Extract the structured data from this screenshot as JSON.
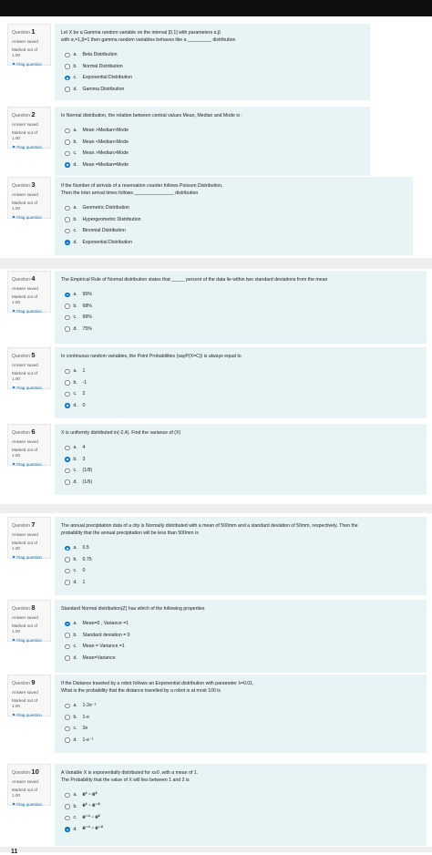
{
  "questions": [
    {
      "label": "Question",
      "num": "1",
      "state": "Answer saved",
      "mark_label": "Marked out of",
      "mark": "1.00",
      "flag": "Flag question",
      "text": [
        "Let X be a Gamma random variable  on the interval [0,1] with parameters α,β",
        "with   α,=1,β=1 then gamma random variables behaves like a _________ distribution"
      ],
      "options": [
        {
          "l": "a.",
          "t": "Beta Distribution",
          "sel": false
        },
        {
          "l": "b.",
          "t": "Normal Distribution",
          "sel": false
        },
        {
          "l": "c.",
          "t": "Exponential Distribution",
          "sel": true
        },
        {
          "l": "d.",
          "t": "Gamma Distribution",
          "sel": false
        }
      ]
    },
    {
      "label": "Question",
      "num": "2",
      "state": "Answer saved",
      "mark_label": "Marked out of",
      "mark": "1.00",
      "flag": "Flag question",
      "text": [
        "In Normal distribution, the relation between central values Mean, Median and Mode is :"
      ],
      "options": [
        {
          "l": "a.",
          "t": "Mean >Median<Mode",
          "sel": false
        },
        {
          "l": "b.",
          "t": "Mean <Median<Mode",
          "sel": false
        },
        {
          "l": "c.",
          "t": "Mean >Median>Mode",
          "sel": false
        },
        {
          "l": "d.",
          "t": "Mean =Median=Mode",
          "sel": true
        }
      ]
    },
    {
      "label": "Question",
      "num": "3",
      "state": "Answer saved",
      "mark_label": "Marked out of",
      "mark": "1.00",
      "flag": "Flag question",
      "text": [
        "If the Number of arrivals of a reservation counter follows Poisson Distribution,",
        "Then the Inter arrival times follows _______________ distribution"
      ],
      "options": [
        {
          "l": "a.",
          "t": "Geometric Distribution",
          "sel": false
        },
        {
          "l": "b.",
          "t": "Hypergeometric Distribution",
          "sel": false
        },
        {
          "l": "c.",
          "t": "Binomial Distribution",
          "sel": false
        },
        {
          "l": "d.",
          "t": "Exponential Distribution",
          "sel": true
        }
      ]
    },
    {
      "label": "Question",
      "num": "4",
      "state": "Answer saved",
      "mark_label": "Marked out of",
      "mark": "1.00",
      "flag": "Flag question",
      "text": [
        "The Empirical Rule of Normal distribution states that _____ percent of the data lie  within two standard deviations from the mean"
      ],
      "options": [
        {
          "l": "a.",
          "t": "95%",
          "sel": true
        },
        {
          "l": "b.",
          "t": "68%",
          "sel": false
        },
        {
          "l": "c.",
          "t": "99%",
          "sel": false
        },
        {
          "l": "d.",
          "t": "75%",
          "sel": false
        }
      ]
    },
    {
      "label": "Question",
      "num": "5",
      "state": "Answer saved",
      "mark_label": "Marked out of",
      "mark": "1.00",
      "flag": "Flag question",
      "text": [
        "In continuous random variables, the Point Probabilities (sayP(X=C)) is always equal to"
      ],
      "options": [
        {
          "l": "a.",
          "t": "1",
          "sel": false
        },
        {
          "l": "b.",
          "t": "-1",
          "sel": false
        },
        {
          "l": "c.",
          "t": "2",
          "sel": false
        },
        {
          "l": "d.",
          "t": "0",
          "sel": true
        }
      ]
    },
    {
      "label": "Question",
      "num": "6",
      "state": "Answer saved",
      "mark_label": "Marked out of",
      "mark": "1.00",
      "flag": "Flag question",
      "text": [
        "X is uniformly distributed in(-2,4). Find the variance of (X)"
      ],
      "options": [
        {
          "l": "a.",
          "t": "4",
          "sel": false
        },
        {
          "l": "b.",
          "t": "3",
          "sel": true
        },
        {
          "l": "c.",
          "t": "(1/8)",
          "sel": false
        },
        {
          "l": "d.",
          "t": "(1/6)",
          "sel": false
        }
      ]
    },
    {
      "label": "Question",
      "num": "7",
      "state": "Answer saved",
      "mark_label": "Marked out of",
      "mark": "1.00",
      "flag": "Flag question",
      "text": [
        "The annual precipitation data of a city is Normally distributed with a mean of  500mm and a standard deviation of 50mm, respectively. Then the",
        "probability that the annual precipitation will be less than 500mm is"
      ],
      "options": [
        {
          "l": "a.",
          "t": "0.5",
          "sel": true
        },
        {
          "l": "b.",
          "t": "0.75",
          "sel": false
        },
        {
          "l": "c.",
          "t": "0",
          "sel": false
        },
        {
          "l": "d.",
          "t": "1",
          "sel": false
        }
      ]
    },
    {
      "label": "Question",
      "num": "8",
      "state": "Answer saved",
      "mark_label": "Marked out of",
      "mark": "1.00",
      "flag": "Flag question",
      "text": [
        "Standard Normal distribution(Z) has which of the following properties"
      ],
      "options": [
        {
          "l": "a.",
          "t": "Mean=0 , Variance =1",
          "sel": true
        },
        {
          "l": "b.",
          "t": "Standard deviation = 0",
          "sel": false
        },
        {
          "l": "c.",
          "t": "Mean = Variance =1",
          "sel": false
        },
        {
          "l": "d.",
          "t": "Mean=Variance",
          "sel": false
        }
      ]
    },
    {
      "label": "Question",
      "num": "9",
      "state": "Answer saved",
      "mark_label": "Marked out of",
      "mark": "1.00",
      "flag": "Flag question",
      "text": [
        "If the Distance traveled by a robot follows an Exponential distribution with parameter λ=0.01,",
        "What is the probability that the distance travelled by a robot  is at most 100 is"
      ],
      "options": [
        {
          "l": "a.",
          "t": "1-2e⁻¹",
          "sel": false
        },
        {
          "l": "b.",
          "t": "1-e",
          "sel": false
        },
        {
          "l": "c.",
          "t": "2e",
          "sel": false
        },
        {
          "l": "d.",
          "t": "1-e⁻¹",
          "sel": false
        }
      ]
    },
    {
      "label": "Question",
      "num": "10",
      "state": "Answer saved",
      "mark_label": "Marked out of",
      "mark": "1.00",
      "flag": "Flag question",
      "text": [
        "A Variable X is exponentially distributed for x≥0 ,with a mean of 1.",
        "The Probability that the value of X will lies between 1 and 2 is"
      ],
      "options": [
        {
          "l": "a.",
          "t": "e¹ - e²",
          "sel": false
        },
        {
          "l": "b.",
          "t": "e¹ - e⁻²",
          "sel": false
        },
        {
          "l": "c.",
          "t": "e⁻¹ - e²",
          "sel": false
        },
        {
          "l": "d.",
          "t": "e⁻¹ - e⁻²",
          "sel": true
        }
      ]
    }
  ],
  "next_num": "11"
}
